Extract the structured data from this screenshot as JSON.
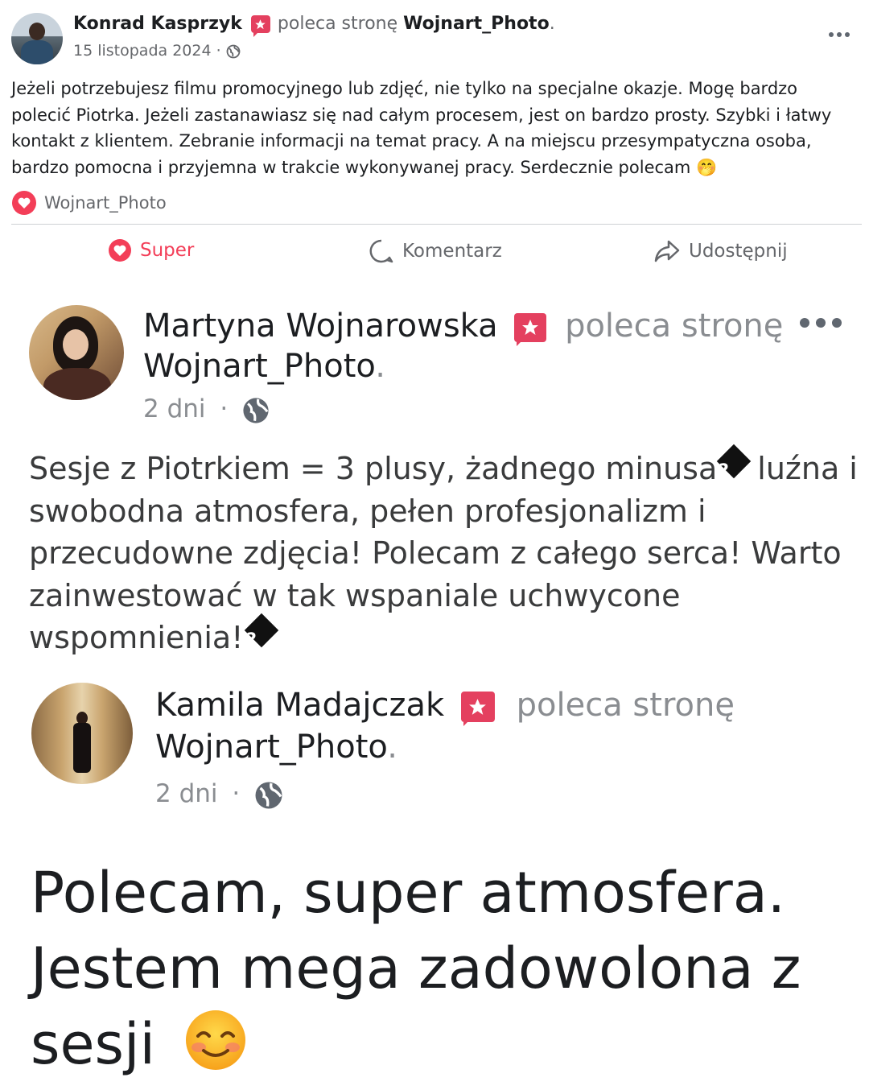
{
  "post1": {
    "author": "Konrad Kasprzyk",
    "recommends_text": "poleca stronę",
    "page_name": "Wojnart_Photo",
    "date": "15 listopada 2024",
    "body": "Jeżeli potrzebujesz filmu promocyjnego lub zdjęć, nie tylko na specjalne okazje. Mogę bardzo polecić Piotrka. Jeżeli zastanawiasz się nad całym procesem, jest on bardzo prosty. Szybki i łatwy kontakt z klientem. Zebranie informacji na temat pracy. A na miejscu przesympatyczna osoba, bardzo pomocna i przyjemna w trakcie wykonywanej pracy. Serdecznie polecam",
    "body_emoji": "🤭",
    "reaction_name": "Wojnart_Photo",
    "actions": {
      "react_label": "Super",
      "comment_label": "Komentarz",
      "share_label": "Udostępnij"
    }
  },
  "post2": {
    "author": "Martyna Wojnarowska",
    "recommends_text": "poleca stronę",
    "page_name": "Wojnart_Photo",
    "time": "2 dni",
    "body_lines": [
      "Sesje z Piotrkiem = 3 plusy, żadnego minusa",
      "luźna i",
      "swobodna atmosfera, pełen profesjonalizm i",
      "przecudowne zdjęcia! Polecam z całego serca! Warto",
      "zainwestować w tak wspaniale uchwycone",
      "wspomnienia!"
    ]
  },
  "post3": {
    "author": "Kamila Madajczak",
    "recommends_text": "poleca stronę",
    "page_name": "Wojnart_Photo",
    "time": "2 dni",
    "body_lines": [
      "Polecam, super atmosfera.",
      "Jestem mega zadowolona z",
      "sesji"
    ],
    "body_emoji": "😊"
  },
  "colors": {
    "accent_red": "#e4405f",
    "super_red": "#f33e58",
    "text_muted": "#65676b"
  }
}
